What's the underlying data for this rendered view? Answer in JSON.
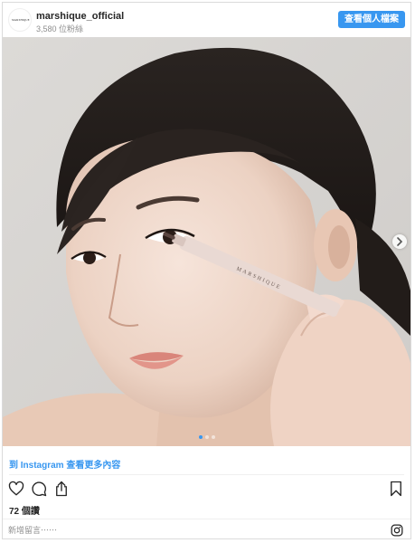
{
  "header": {
    "avatar_text": "MARSHIQUE",
    "username": "marshique_official",
    "followers": "3,580 位粉絲",
    "profile_button": "查看個人檔案"
  },
  "photo": {
    "pen_text": "MARSHIQUE",
    "carousel": {
      "count": 3,
      "active": 1
    }
  },
  "more_link": "到 Instagram 查看更多內容",
  "actions": {
    "icons": [
      "heart-icon",
      "comment-icon",
      "share-icon",
      "bookmark-icon"
    ]
  },
  "likes": "72 個讚",
  "comment": {
    "placeholder": "新增留言⋯⋯"
  },
  "colors": {
    "accent": "#3897f0",
    "text": "#262626",
    "muted": "#8e8e8e",
    "border": "#dbdbdb"
  }
}
